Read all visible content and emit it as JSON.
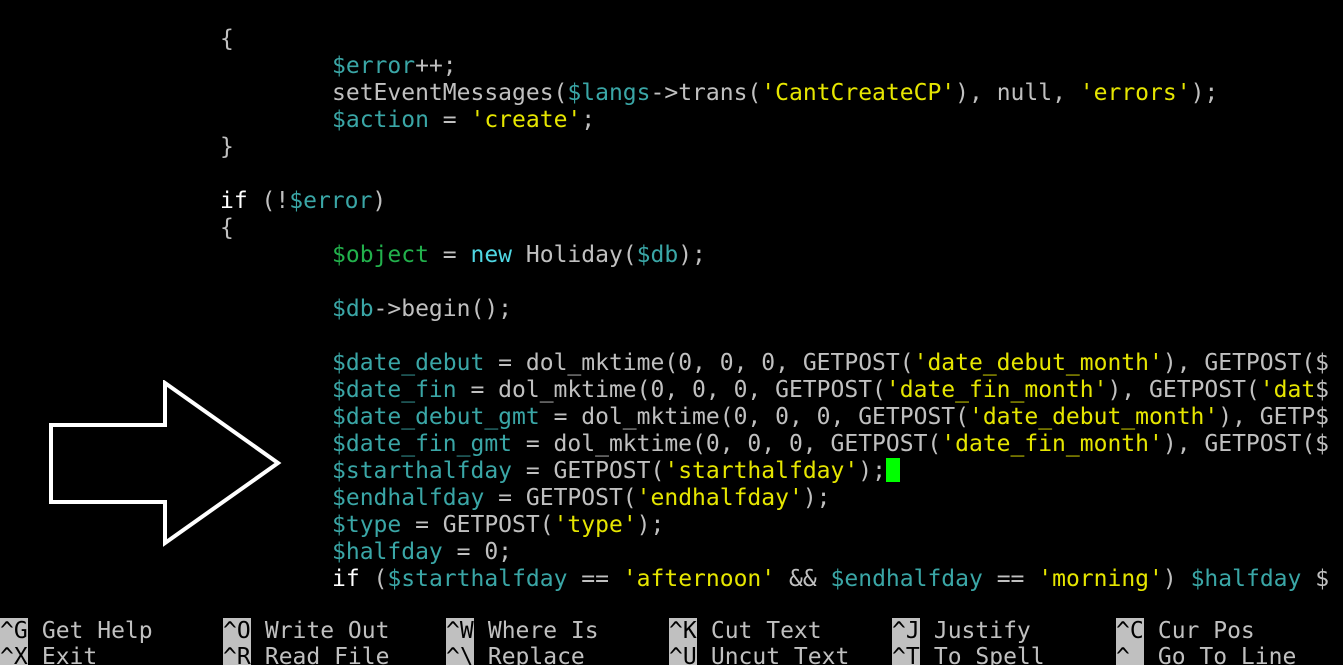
{
  "editor": {
    "lines": [
      {
        "tokens": [
          {
            "t": "{",
            "c": "plain"
          }
        ]
      },
      {
        "tokens": [
          {
            "t": "$error",
            "c": "var"
          },
          {
            "t": "++;",
            "c": "plain"
          }
        ]
      },
      {
        "tokens": [
          {
            "t": "setEventMessages(",
            "c": "plain"
          },
          {
            "t": "$langs",
            "c": "var"
          },
          {
            "t": "->trans(",
            "c": "plain"
          },
          {
            "t": "'CantCreateCP'",
            "c": "string"
          },
          {
            "t": "), null, ",
            "c": "plain"
          },
          {
            "t": "'errors'",
            "c": "string"
          },
          {
            "t": ");",
            "c": "plain"
          }
        ]
      },
      {
        "tokens": [
          {
            "t": "$action",
            "c": "var"
          },
          {
            "t": " = ",
            "c": "plain"
          },
          {
            "t": "'create'",
            "c": "string"
          },
          {
            "t": ";",
            "c": "plain"
          }
        ]
      },
      {
        "tokens": [
          {
            "t": "}",
            "c": "plain"
          }
        ]
      },
      {
        "tokens": []
      },
      {
        "tokens": [
          {
            "t": "if",
            "c": "if"
          },
          {
            "t": " (!",
            "c": "plain"
          },
          {
            "t": "$error",
            "c": "var"
          },
          {
            "t": ")",
            "c": "plain"
          }
        ]
      },
      {
        "tokens": [
          {
            "t": "{",
            "c": "plain"
          }
        ]
      },
      {
        "tokens": [
          {
            "t": "$object",
            "c": "obj"
          },
          {
            "t": " = ",
            "c": "plain"
          },
          {
            "t": "new",
            "c": "new"
          },
          {
            "t": " Holiday(",
            "c": "plain"
          },
          {
            "t": "$db",
            "c": "var"
          },
          {
            "t": ");",
            "c": "plain"
          }
        ]
      },
      {
        "tokens": []
      },
      {
        "tokens": [
          {
            "t": "$db",
            "c": "var"
          },
          {
            "t": "->begin();",
            "c": "plain"
          }
        ]
      },
      {
        "tokens": []
      },
      {
        "tokens": [
          {
            "t": "$date_debut",
            "c": "var"
          },
          {
            "t": " = dol_mktime(0, 0, 0, GETPOST(",
            "c": "plain"
          },
          {
            "t": "'date_debut_month'",
            "c": "string"
          },
          {
            "t": "), GETPOST(",
            "c": "plain"
          },
          {
            "t": "$",
            "c": "trunc"
          }
        ]
      },
      {
        "tokens": [
          {
            "t": "$date_fin",
            "c": "var"
          },
          {
            "t": " = dol_mktime(0, 0, 0, GETPOST(",
            "c": "plain"
          },
          {
            "t": "'date_fin_month'",
            "c": "string"
          },
          {
            "t": "), GETPOST(",
            "c": "plain"
          },
          {
            "t": "'dat",
            "c": "string"
          },
          {
            "t": "$",
            "c": "trunc"
          }
        ]
      },
      {
        "tokens": [
          {
            "t": "$date_debut_gmt",
            "c": "var"
          },
          {
            "t": " = dol_mktime(0, 0, 0, GETPOST(",
            "c": "plain"
          },
          {
            "t": "'date_debut_month'",
            "c": "string"
          },
          {
            "t": "), GETP",
            "c": "plain"
          },
          {
            "t": "$",
            "c": "trunc"
          }
        ]
      },
      {
        "tokens": [
          {
            "t": "$date_fin_gmt",
            "c": "var"
          },
          {
            "t": " = dol_mktime(0, 0, 0, GETPOST(",
            "c": "plain"
          },
          {
            "t": "'date_fin_month'",
            "c": "string"
          },
          {
            "t": "), GETPOST(",
            "c": "plain"
          },
          {
            "t": "$",
            "c": "trunc"
          }
        ]
      },
      {
        "tokens": [
          {
            "t": "$starthalfday",
            "c": "var"
          },
          {
            "t": " = GETPOST(",
            "c": "plain"
          },
          {
            "t": "'starthalfday'",
            "c": "string"
          },
          {
            "t": ");",
            "c": "plain"
          }
        ],
        "cursor": true
      },
      {
        "tokens": [
          {
            "t": "$endhalfday",
            "c": "var"
          },
          {
            "t": " = GETPOST(",
            "c": "plain"
          },
          {
            "t": "'endhalfday'",
            "c": "string"
          },
          {
            "t": ");",
            "c": "plain"
          }
        ]
      },
      {
        "tokens": [
          {
            "t": "$type",
            "c": "var"
          },
          {
            "t": " = GETPOST(",
            "c": "plain"
          },
          {
            "t": "'type'",
            "c": "string"
          },
          {
            "t": ");",
            "c": "plain"
          }
        ]
      },
      {
        "tokens": [
          {
            "t": "$halfday",
            "c": "var"
          },
          {
            "t": " = 0;",
            "c": "plain"
          }
        ]
      },
      {
        "tokens": [
          {
            "t": "if",
            "c": "if"
          },
          {
            "t": " (",
            "c": "plain"
          },
          {
            "t": "$starthalfday",
            "c": "var"
          },
          {
            "t": " == ",
            "c": "plain"
          },
          {
            "t": "'afternoon'",
            "c": "string"
          },
          {
            "t": " && ",
            "c": "plain"
          },
          {
            "t": "$endhalfday",
            "c": "var"
          },
          {
            "t": " == ",
            "c": "plain"
          },
          {
            "t": "'morning'",
            "c": "string"
          },
          {
            "t": ") ",
            "c": "plain"
          },
          {
            "t": "$halfday",
            "c": "var"
          },
          {
            "t": " $",
            "c": "trunc"
          }
        ]
      }
    ]
  },
  "shortcuts": {
    "row1": [
      {
        "key": "^G",
        "label": "Get Help"
      },
      {
        "key": "^O",
        "label": "Write Out"
      },
      {
        "key": "^W",
        "label": "Where Is"
      },
      {
        "key": "^K",
        "label": "Cut Text"
      },
      {
        "key": "^J",
        "label": "Justify"
      },
      {
        "key": "^C",
        "label": "Cur Pos"
      }
    ],
    "row2": [
      {
        "key": "^X",
        "label": "Exit"
      },
      {
        "key": "^R",
        "label": "Read File"
      },
      {
        "key": "^\\",
        "label": "Replace"
      },
      {
        "key": "^U",
        "label": "Uncut Text"
      },
      {
        "key": "^T",
        "label": "To Spell"
      },
      {
        "key": "^_",
        "label": "Go To Line"
      }
    ]
  },
  "annotation": {
    "icon": "right-arrow-icon",
    "color": "#ffffff"
  },
  "colors": {
    "background": "#000000",
    "plain": "#c0c0c0",
    "variable": "#3aa6a6",
    "string": "#e6e600",
    "cursor": "#00ff00"
  }
}
